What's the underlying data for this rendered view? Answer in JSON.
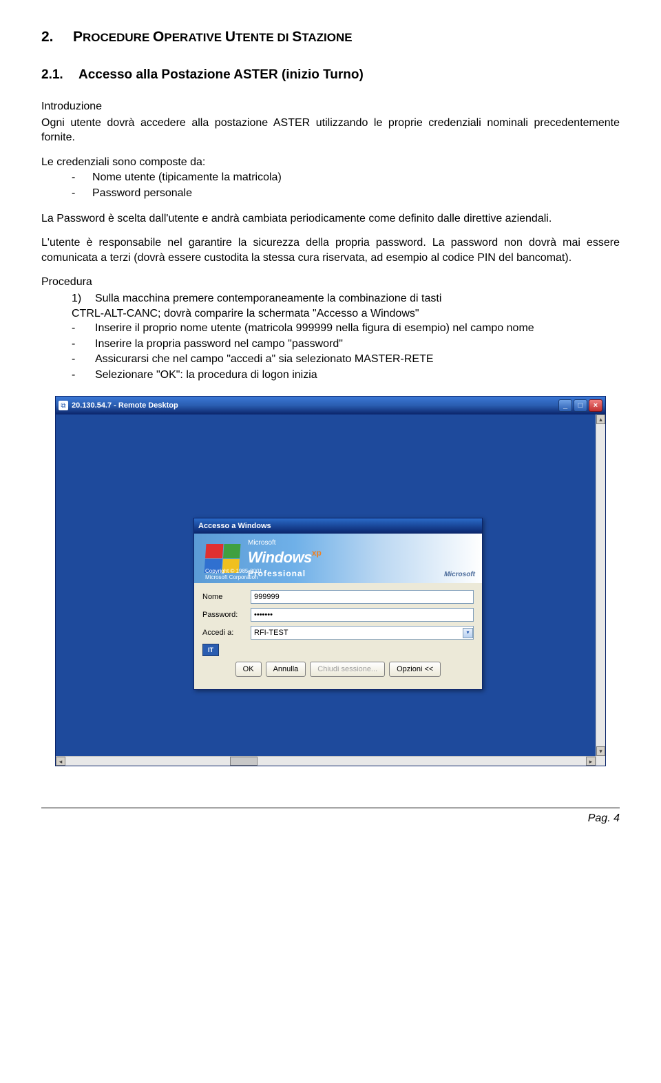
{
  "heading1": {
    "num": "2.",
    "text_pre": "P",
    "text_sc1": "ROCEDURE ",
    "text_b1": "O",
    "text_sc2": "PERATIVE ",
    "text_b2": "U",
    "text_sc3": "TENTE DI ",
    "text_b3": "S",
    "text_sc4": "TAZIONE"
  },
  "heading2": {
    "num": "2.1.",
    "text": "Accesso alla Postazione ASTER (inizio Turno)"
  },
  "intro": {
    "label": "Introduzione",
    "p1": "Ogni utente dovrà accedere alla postazione ASTER utilizzando le proprie credenziali nominali precedentemente fornite.",
    "p2_lead": "Le credenziali sono composte da:",
    "bullets": [
      "Nome utente (tipicamente la matricola)",
      "Password personale"
    ],
    "p3": "La Password è scelta dall'utente e andrà cambiata periodicamente come definito dalle direttive aziendali.",
    "p4": "L'utente è responsabile nel garantire la sicurezza della propria password. La password non dovrà mai essere comunicata a terzi (dovrà essere custodita la stessa cura riservata, ad esempio al codice PIN del bancomat)."
  },
  "procedura": {
    "label": "Procedura",
    "step1_marker": "1)",
    "step1_line1": "Sulla macchina premere contemporaneamente la combinazione di tasti",
    "step1_line2": "CTRL-ALT-CANC; dovrà comparire la schermata \"Accesso a Windows\"",
    "bullets": [
      "Inserire il proprio nome utente (matricola 999999 nella figura di esempio) nel campo nome",
      "Inserire la propria password nel campo \"password\"",
      "Assicurarsi che nel campo \"accedi a\" sia selezionato MASTER-RETE",
      "Selezionare \"OK\": la procedura di logon inizia"
    ]
  },
  "screenshot": {
    "rd_title": "20.130.54.7 - Remote Desktop",
    "win_min": "_",
    "win_max": "□",
    "win_close": "×",
    "dialog_title": "Accesso a Windows",
    "brand_ms": "Microsoft",
    "brand_win": "Windows",
    "brand_xp": "xp",
    "brand_prof": "Professional",
    "copyright": "Copyright © 1985-2001\nMicrosoft Corporation",
    "msft_tag": "Microsoft",
    "lbl_nome": "Nome",
    "val_nome": "999999",
    "lbl_pass": "Password:",
    "val_pass": "•••••••",
    "lbl_accedi": "Accedi a:",
    "val_accedi": "RFI-TEST",
    "lang": "IT",
    "btn_ok": "OK",
    "btn_annulla": "Annulla",
    "btn_chiudi": "Chiudi sessione...",
    "btn_opzioni": "Opzioni <<"
  },
  "footer": {
    "page": "Pag. 4"
  }
}
